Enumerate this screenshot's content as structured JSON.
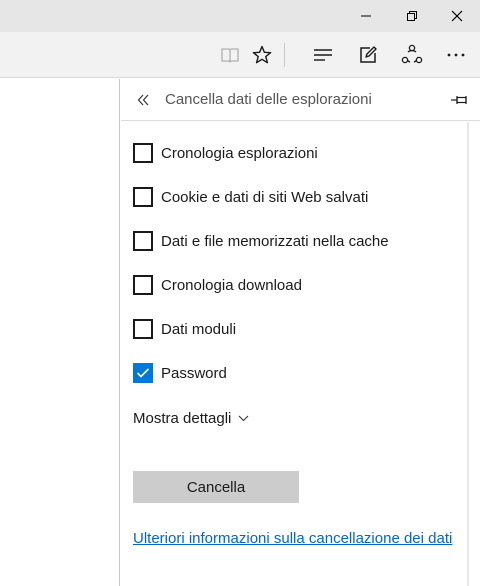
{
  "window": {
    "minimize_icon": "minimize-icon",
    "maximize_icon": "restore-icon",
    "close_icon": "close-icon"
  },
  "toolbar": {
    "icons": [
      "reading-view-icon",
      "favorite-star-icon",
      "hub-icon",
      "web-note-icon",
      "share-icon",
      "more-icon"
    ]
  },
  "pane": {
    "title": "Cancella dati delle esplorazioni",
    "back_icon": "double-chevron-left-icon",
    "pin_icon": "pin-icon",
    "options": [
      {
        "label": "Cronologia esplorazioni",
        "checked": false
      },
      {
        "label": "Cookie e dati di siti Web salvati",
        "checked": false
      },
      {
        "label": "Dati e file memorizzati nella cache",
        "checked": false
      },
      {
        "label": "Cronologia download",
        "checked": false
      },
      {
        "label": "Dati moduli",
        "checked": false
      },
      {
        "label": "Password",
        "checked": true
      }
    ],
    "show_details": "Mostra dettagli",
    "clear_button": "Cancella",
    "more_info_link": "Ulteriori informazioni sulla cancellazione dei dati"
  },
  "colors": {
    "accent": "#0078d7",
    "link": "#0066cc",
    "titlebar": "#e6e6e6",
    "toolbar": "#f2f2f2",
    "button": "#cccccc"
  }
}
